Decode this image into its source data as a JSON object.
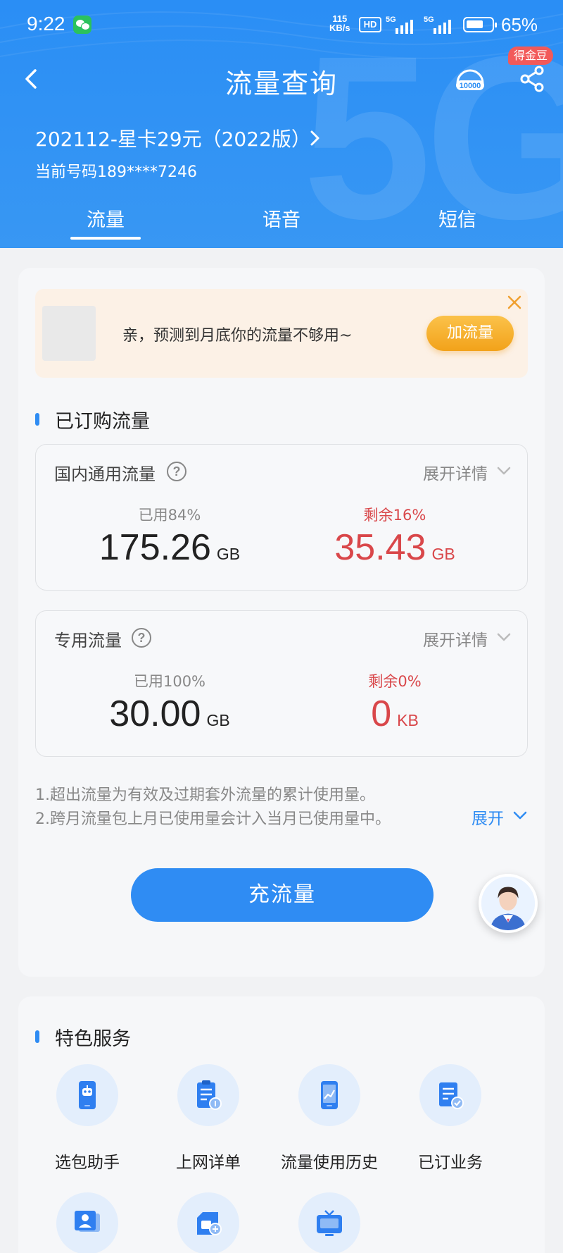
{
  "status_bar": {
    "time": "9:22",
    "net_speed_value": "115",
    "net_speed_unit": "KB/s",
    "hd_label": "HD",
    "sig1_label": "5G",
    "sig2_label": "5G",
    "battery_percent": "65%",
    "battery_level": 0.65
  },
  "header": {
    "title": "流量查询",
    "badge": "得金豆",
    "plan_name": "202112-星卡29元（2022版）",
    "current_number": "当前号码189****7246",
    "hotline_icon": "hotline-10000-icon",
    "share_icon": "share-icon"
  },
  "tabs": [
    {
      "label": "流量",
      "active": true
    },
    {
      "label": "语音",
      "active": false
    },
    {
      "label": "短信",
      "active": false
    }
  ],
  "promo": {
    "text": "亲，预测到月底你的流量不够用~",
    "button": "加流量"
  },
  "subscribed": {
    "section_title": "已订购流量",
    "domestic": {
      "name": "国内通用流量",
      "expand": "展开详情",
      "used_label": "已用84%",
      "used_value": "175.26",
      "used_unit": "GB",
      "remain_label": "剩余16%",
      "remain_value": "35.43",
      "remain_unit": "GB"
    },
    "dedicated": {
      "name": "专用流量",
      "expand": "展开详情",
      "used_label": "已用100%",
      "used_value": "30.00",
      "used_unit": "GB",
      "remain_label": "剩余0%",
      "remain_value": "0",
      "remain_unit": "KB"
    }
  },
  "notes": {
    "line1": "1.超出流量为有效及过期套外流量的累计使用量。",
    "line2": "2.跨月流量包上月已使用量会计入当月已使用量中。",
    "expand": "展开"
  },
  "recharge_button": "充流量",
  "services": {
    "section_title": "特色服务",
    "items": [
      {
        "label": "选包助手",
        "icon": "robot-phone-icon"
      },
      {
        "label": "上网详单",
        "icon": "clipboard-list-icon"
      },
      {
        "label": "流量使用历史",
        "icon": "phone-chart-icon"
      },
      {
        "label": "已订业务",
        "icon": "document-check-icon"
      },
      {
        "label": "",
        "icon": "contact-card-icon"
      },
      {
        "label": "",
        "icon": "sim-card-add-icon"
      },
      {
        "label": "",
        "icon": "tv-icon"
      }
    ]
  },
  "colors": {
    "header_blue": "#2a8ef5",
    "accent_blue": "#2f8cf3",
    "remain_red": "#d9474a",
    "promo_orange": "#f2a21a"
  }
}
